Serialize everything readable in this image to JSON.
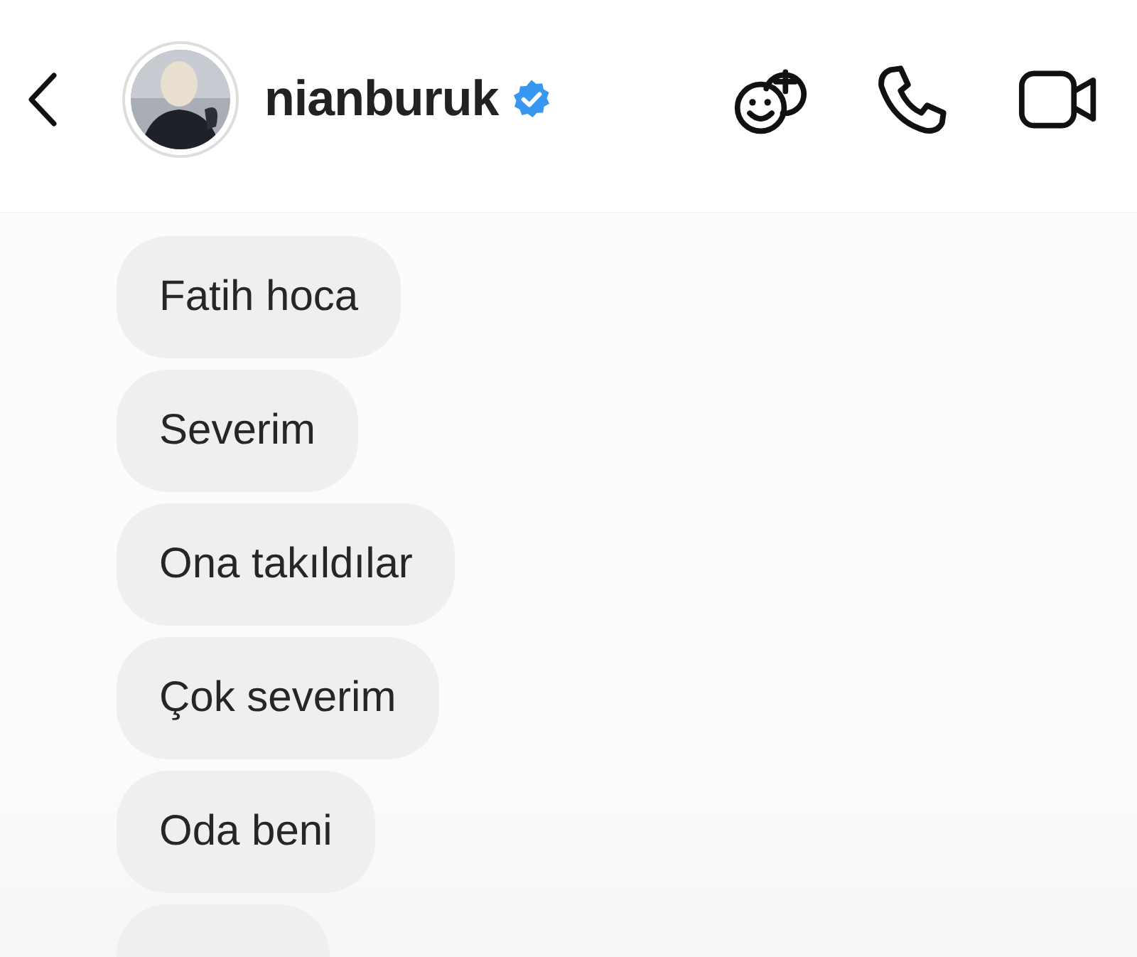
{
  "header": {
    "username": "nianburuk",
    "verified": true
  },
  "messages": [
    {
      "text": "Fatih hoca"
    },
    {
      "text": "Severim"
    },
    {
      "text": "Ona takıldılar"
    },
    {
      "text": "Çok severim"
    },
    {
      "text": "Oda beni"
    }
  ],
  "partial_bubble": true
}
